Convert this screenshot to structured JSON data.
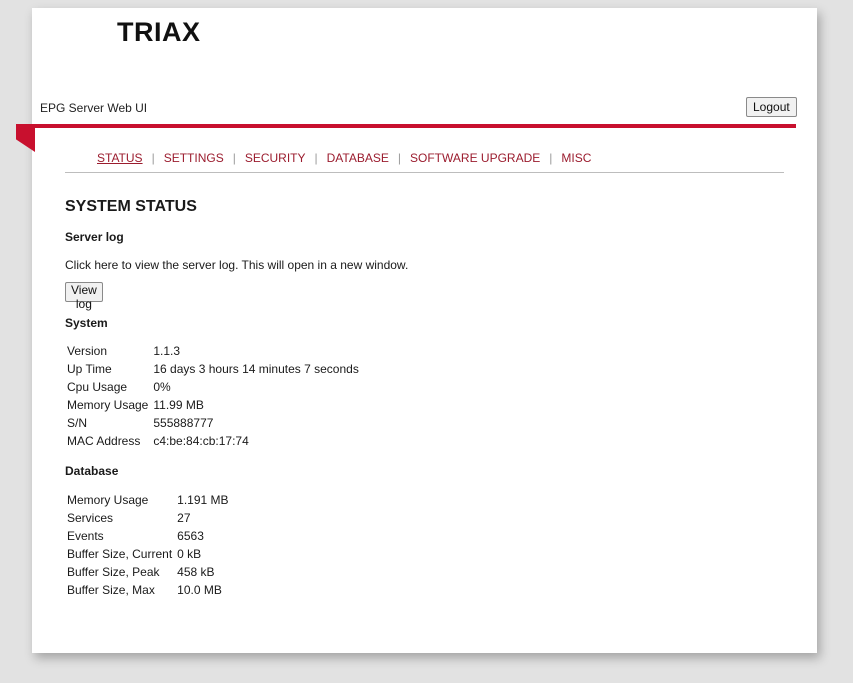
{
  "brand": {
    "logo": "TRIAX",
    "accent_color": "#c8102e",
    "link_color": "#9b1c2e"
  },
  "header": {
    "app_title": "EPG Server Web UI",
    "logout_label": "Logout"
  },
  "nav": {
    "items": [
      {
        "label": "STATUS",
        "active": true
      },
      {
        "label": "SETTINGS",
        "active": false
      },
      {
        "label": "SECURITY",
        "active": false
      },
      {
        "label": "DATABASE",
        "active": false
      },
      {
        "label": "SOFTWARE UPGRADE",
        "active": false
      },
      {
        "label": "MISC",
        "active": false
      }
    ],
    "separator": "|"
  },
  "main": {
    "title": "SYSTEM STATUS",
    "server_log": {
      "heading": "Server log",
      "description": "Click here to view the server log. This will open in a new window.",
      "button_label": "View log"
    },
    "system": {
      "heading": "System",
      "rows": [
        {
          "key": "Version",
          "value": "1.1.3"
        },
        {
          "key": "Up Time",
          "value": "16 days 3 hours 14 minutes 7 seconds"
        },
        {
          "key": "Cpu Usage",
          "value": "0%"
        },
        {
          "key": "Memory Usage",
          "value": "11.99 MB"
        },
        {
          "key": "S/N",
          "value": "555888777"
        },
        {
          "key": "MAC Address",
          "value": "c4:be:84:cb:17:74"
        }
      ]
    },
    "database": {
      "heading": "Database",
      "rows": [
        {
          "key": "Memory Usage",
          "value": "1.191 MB"
        },
        {
          "key": "Services",
          "value": "27"
        },
        {
          "key": "Events",
          "value": "6563"
        },
        {
          "key": "Buffer Size, Current",
          "value": "0 kB"
        },
        {
          "key": "Buffer Size, Peak",
          "value": "458 kB"
        },
        {
          "key": "Buffer Size, Max",
          "value": "10.0 MB"
        }
      ]
    }
  }
}
